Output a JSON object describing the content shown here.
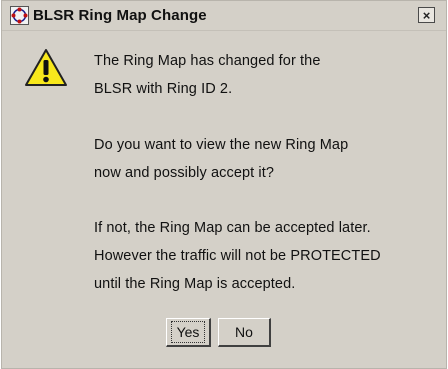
{
  "window": {
    "title": "BLSR Ring Map Change",
    "close_glyph": "×",
    "icon": "app-icon",
    "accent_color": "#d4d0c8"
  },
  "message": {
    "icon": "warning-icon",
    "paragraph1": [
      "The Ring Map has changed for the",
      "BLSR with Ring ID 2."
    ],
    "paragraph2": [
      "Do you want to view the new Ring Map",
      "now and possibly accept it?"
    ],
    "paragraph3": [
      "If not, the Ring Map can be accepted later.",
      "However the traffic will not be PROTECTED",
      "until the Ring Map is accepted."
    ]
  },
  "buttons": {
    "yes_label": "Yes",
    "no_label": "No"
  }
}
